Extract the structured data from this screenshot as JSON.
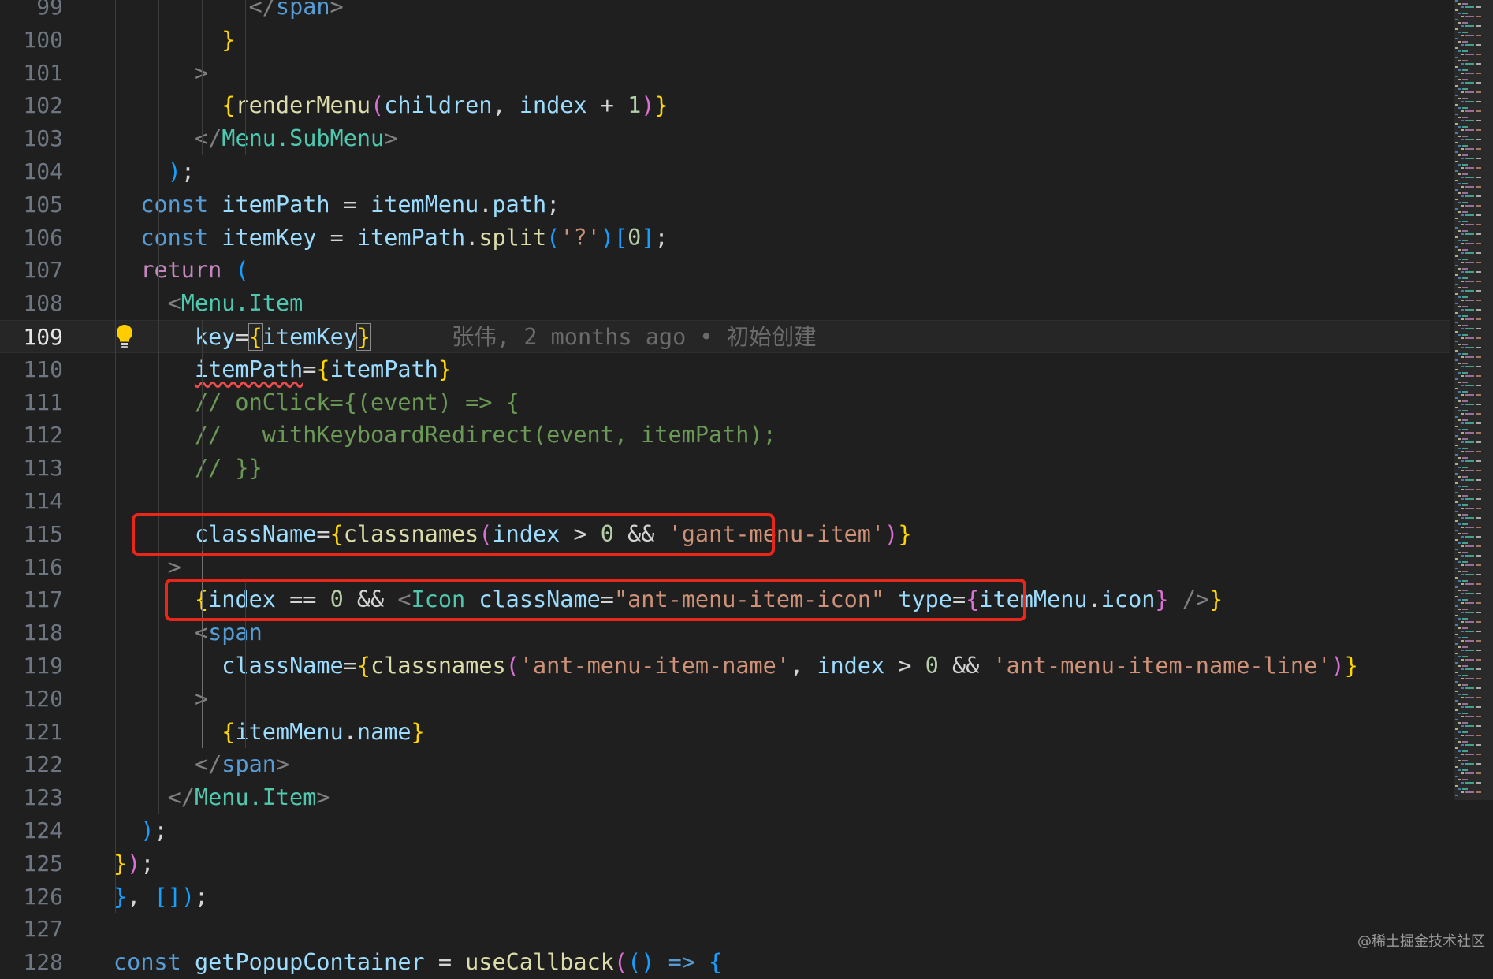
{
  "colors": {
    "background": "#1f1f1f",
    "line_number": "#6e7681",
    "current_line_number": "#e6e6e6",
    "keyword_blue": "#569cd6",
    "keyword_pink": "#c586c0",
    "variable": "#9cdcfe",
    "component": "#4ec9b0",
    "string": "#ce9178",
    "number": "#b5cea8",
    "function": "#dcdcaa",
    "comment": "#6a9955",
    "bracket_gold": "#ffd700",
    "bracket_pink": "#da70d6",
    "bracket_blue": "#179fff",
    "punctuation": "#808080",
    "annotation_red": "#e8271b"
  },
  "editor": {
    "current_line": 109,
    "lightbulb_icon": "lightbulb-icon",
    "lines": [
      {
        "num": "99",
        "tokens": [
          {
            "t": "          </",
            "c": "punctuation"
          },
          {
            "t": "span",
            "c": "keyword_blue"
          },
          {
            "t": ">",
            "c": "punctuation"
          }
        ]
      },
      {
        "num": "100",
        "tokens": [
          {
            "t": "        ",
            "c": "plain"
          },
          {
            "t": "}",
            "c": "bracket_gold"
          }
        ]
      },
      {
        "num": "101",
        "tokens": [
          {
            "t": "      >",
            "c": "punctuation"
          }
        ]
      },
      {
        "num": "102",
        "tokens": [
          {
            "t": "        ",
            "c": "plain"
          },
          {
            "t": "{",
            "c": "bracket_gold"
          },
          {
            "t": "renderMenu",
            "c": "function"
          },
          {
            "t": "(",
            "c": "bracket_pink"
          },
          {
            "t": "children",
            "c": "variable"
          },
          {
            "t": ", ",
            "c": "plain"
          },
          {
            "t": "index",
            "c": "variable"
          },
          {
            "t": " + ",
            "c": "plain"
          },
          {
            "t": "1",
            "c": "number"
          },
          {
            "t": ")",
            "c": "bracket_pink"
          },
          {
            "t": "}",
            "c": "bracket_gold"
          }
        ]
      },
      {
        "num": "103",
        "tokens": [
          {
            "t": "      </",
            "c": "punctuation"
          },
          {
            "t": "Menu.SubMenu",
            "c": "component"
          },
          {
            "t": ">",
            "c": "punctuation"
          }
        ]
      },
      {
        "num": "104",
        "tokens": [
          {
            "t": "    ",
            "c": "plain"
          },
          {
            "t": ")",
            "c": "bracket_blue"
          },
          {
            "t": ";",
            "c": "plain"
          }
        ]
      },
      {
        "num": "105",
        "tokens": [
          {
            "t": "  ",
            "c": "plain"
          },
          {
            "t": "const",
            "c": "keyword_blue"
          },
          {
            "t": " ",
            "c": "plain"
          },
          {
            "t": "itemPath",
            "c": "variable"
          },
          {
            "t": " = ",
            "c": "plain"
          },
          {
            "t": "itemMenu",
            "c": "variable"
          },
          {
            "t": ".",
            "c": "plain"
          },
          {
            "t": "path",
            "c": "variable"
          },
          {
            "t": ";",
            "c": "plain"
          }
        ]
      },
      {
        "num": "106",
        "tokens": [
          {
            "t": "  ",
            "c": "plain"
          },
          {
            "t": "const",
            "c": "keyword_blue"
          },
          {
            "t": " ",
            "c": "plain"
          },
          {
            "t": "itemKey",
            "c": "variable"
          },
          {
            "t": " = ",
            "c": "plain"
          },
          {
            "t": "itemPath",
            "c": "variable"
          },
          {
            "t": ".",
            "c": "plain"
          },
          {
            "t": "split",
            "c": "function"
          },
          {
            "t": "(",
            "c": "bracket_blue"
          },
          {
            "t": "'?'",
            "c": "string"
          },
          {
            "t": ")",
            "c": "bracket_blue"
          },
          {
            "t": "[",
            "c": "bracket_blue"
          },
          {
            "t": "0",
            "c": "number"
          },
          {
            "t": "]",
            "c": "bracket_blue"
          },
          {
            "t": ";",
            "c": "plain"
          }
        ]
      },
      {
        "num": "107",
        "tokens": [
          {
            "t": "  ",
            "c": "plain"
          },
          {
            "t": "return",
            "c": "keyword_pink"
          },
          {
            "t": " ",
            "c": "plain"
          },
          {
            "t": "(",
            "c": "bracket_blue"
          }
        ]
      },
      {
        "num": "108",
        "tokens": [
          {
            "t": "    <",
            "c": "punctuation"
          },
          {
            "t": "Menu.Item",
            "c": "component"
          }
        ]
      },
      {
        "num": "109",
        "tokens": [
          {
            "t": "      ",
            "c": "plain"
          },
          {
            "t": "key",
            "c": "variable"
          },
          {
            "t": "=",
            "c": "plain"
          },
          {
            "t": "{",
            "c": "bracket_gold",
            "box": true
          },
          {
            "t": "itemKey",
            "c": "variable"
          },
          {
            "t": "}",
            "c": "bracket_gold",
            "box": true
          }
        ],
        "blame": "      张伟, 2 months ago • 初始创建"
      },
      {
        "num": "110",
        "tokens": [
          {
            "t": "      ",
            "c": "plain"
          },
          {
            "t": "itemPath",
            "c": "variable",
            "squiggle": true
          },
          {
            "t": "=",
            "c": "plain"
          },
          {
            "t": "{",
            "c": "bracket_gold"
          },
          {
            "t": "itemPath",
            "c": "variable"
          },
          {
            "t": "}",
            "c": "bracket_gold"
          }
        ]
      },
      {
        "num": "111",
        "tokens": [
          {
            "t": "      // onClick={(event) => {",
            "c": "comment"
          }
        ]
      },
      {
        "num": "112",
        "tokens": [
          {
            "t": "      //   withKeyboardRedirect(event, itemPath);",
            "c": "comment"
          }
        ]
      },
      {
        "num": "113",
        "tokens": [
          {
            "t": "      // }}",
            "c": "comment"
          }
        ]
      },
      {
        "num": "114",
        "tokens": []
      },
      {
        "num": "115",
        "tokens": [
          {
            "t": "      ",
            "c": "plain"
          },
          {
            "t": "className",
            "c": "variable"
          },
          {
            "t": "=",
            "c": "plain"
          },
          {
            "t": "{",
            "c": "bracket_gold"
          },
          {
            "t": "classnames",
            "c": "function"
          },
          {
            "t": "(",
            "c": "bracket_pink"
          },
          {
            "t": "index",
            "c": "variable"
          },
          {
            "t": " > ",
            "c": "plain"
          },
          {
            "t": "0",
            "c": "number"
          },
          {
            "t": " && ",
            "c": "plain"
          },
          {
            "t": "'gant-menu-item'",
            "c": "string"
          },
          {
            "t": ")",
            "c": "bracket_pink"
          },
          {
            "t": "}",
            "c": "bracket_gold"
          }
        ]
      },
      {
        "num": "116",
        "tokens": [
          {
            "t": "    >",
            "c": "punctuation"
          }
        ]
      },
      {
        "num": "117",
        "tokens": [
          {
            "t": "      ",
            "c": "plain"
          },
          {
            "t": "{",
            "c": "bracket_gold"
          },
          {
            "t": "index",
            "c": "variable"
          },
          {
            "t": " == ",
            "c": "plain"
          },
          {
            "t": "0",
            "c": "number"
          },
          {
            "t": " && ",
            "c": "plain"
          },
          {
            "t": "<",
            "c": "punctuation"
          },
          {
            "t": "Icon",
            "c": "component"
          },
          {
            "t": " ",
            "c": "plain"
          },
          {
            "t": "className",
            "c": "variable"
          },
          {
            "t": "=",
            "c": "plain"
          },
          {
            "t": "\"ant-menu-item-icon\"",
            "c": "string"
          },
          {
            "t": " ",
            "c": "plain"
          },
          {
            "t": "type",
            "c": "variable"
          },
          {
            "t": "=",
            "c": "plain"
          },
          {
            "t": "{",
            "c": "bracket_pink"
          },
          {
            "t": "itemMenu",
            "c": "variable"
          },
          {
            "t": ".",
            "c": "plain"
          },
          {
            "t": "icon",
            "c": "variable"
          },
          {
            "t": "}",
            "c": "bracket_pink"
          },
          {
            "t": " />",
            "c": "punctuation"
          },
          {
            "t": "}",
            "c": "bracket_gold"
          }
        ]
      },
      {
        "num": "118",
        "tokens": [
          {
            "t": "      <",
            "c": "punctuation"
          },
          {
            "t": "span",
            "c": "keyword_blue"
          }
        ]
      },
      {
        "num": "119",
        "tokens": [
          {
            "t": "        ",
            "c": "plain"
          },
          {
            "t": "className",
            "c": "variable"
          },
          {
            "t": "=",
            "c": "plain"
          },
          {
            "t": "{",
            "c": "bracket_gold"
          },
          {
            "t": "classnames",
            "c": "function"
          },
          {
            "t": "(",
            "c": "bracket_pink"
          },
          {
            "t": "'ant-menu-item-name'",
            "c": "string"
          },
          {
            "t": ", ",
            "c": "plain"
          },
          {
            "t": "index",
            "c": "variable"
          },
          {
            "t": " > ",
            "c": "plain"
          },
          {
            "t": "0",
            "c": "number"
          },
          {
            "t": " && ",
            "c": "plain"
          },
          {
            "t": "'ant-menu-item-name-line'",
            "c": "string"
          },
          {
            "t": ")",
            "c": "bracket_pink"
          },
          {
            "t": "}",
            "c": "bracket_gold"
          }
        ]
      },
      {
        "num": "120",
        "tokens": [
          {
            "t": "      >",
            "c": "punctuation"
          }
        ]
      },
      {
        "num": "121",
        "tokens": [
          {
            "t": "        ",
            "c": "plain"
          },
          {
            "t": "{",
            "c": "bracket_gold"
          },
          {
            "t": "itemMenu",
            "c": "variable"
          },
          {
            "t": ".",
            "c": "plain"
          },
          {
            "t": "name",
            "c": "variable"
          },
          {
            "t": "}",
            "c": "bracket_gold"
          }
        ]
      },
      {
        "num": "122",
        "tokens": [
          {
            "t": "      </",
            "c": "punctuation"
          },
          {
            "t": "span",
            "c": "keyword_blue"
          },
          {
            "t": ">",
            "c": "punctuation"
          }
        ]
      },
      {
        "num": "123",
        "tokens": [
          {
            "t": "    </",
            "c": "punctuation"
          },
          {
            "t": "Menu.Item",
            "c": "component"
          },
          {
            "t": ">",
            "c": "punctuation"
          }
        ]
      },
      {
        "num": "124",
        "tokens": [
          {
            "t": "  ",
            "c": "plain"
          },
          {
            "t": ")",
            "c": "bracket_blue"
          },
          {
            "t": ";",
            "c": "plain"
          }
        ]
      },
      {
        "num": "125",
        "tokens": [
          {
            "t": "}",
            "c": "bracket_gold"
          },
          {
            "t": ")",
            "c": "bracket_pink"
          },
          {
            "t": ";",
            "c": "plain"
          }
        ]
      },
      {
        "num": "126",
        "tokens": [
          {
            "t": "}",
            "c": "bracket_blue"
          },
          {
            "t": ", ",
            "c": "plain"
          },
          {
            "t": "[]",
            "c": "bracket_blue"
          },
          {
            "t": ")",
            "c": "bracket_blue"
          },
          {
            "t": ";",
            "c": "plain"
          }
        ]
      },
      {
        "num": "127",
        "tokens": []
      },
      {
        "num": "128",
        "tokens": [
          {
            "t": "const",
            "c": "keyword_blue"
          },
          {
            "t": " ",
            "c": "plain"
          },
          {
            "t": "getPopupContainer",
            "c": "variable"
          },
          {
            "t": " = ",
            "c": "plain"
          },
          {
            "t": "useCallback",
            "c": "function"
          },
          {
            "t": "(",
            "c": "bracket_pink"
          },
          {
            "t": "()",
            "c": "bracket_blue"
          },
          {
            "t": " => ",
            "c": "keyword_blue"
          },
          {
            "t": "{",
            "c": "bracket_blue"
          }
        ]
      }
    ]
  },
  "watermark": "@稀土掘金技术社区"
}
